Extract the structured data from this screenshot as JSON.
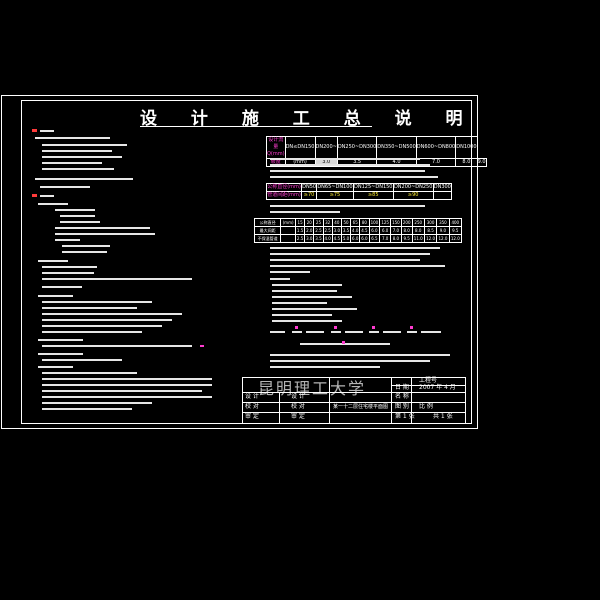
{
  "drawing": {
    "title": "设 计 施 工 总 说 明"
  },
  "table_a": {
    "row1": [
      "设计流量Q(mm)",
      "DN≤DN150",
      "DN200~",
      "DN250~DN300",
      "DN350~DN500",
      "DN600~DN800",
      "DN1000"
    ],
    "row2": [
      "坡度",
      "(mm)",
      "3.0",
      "3.5",
      "4.0",
      "7.0",
      "8.0",
      "9.0"
    ]
  },
  "table_b": {
    "row1": [
      "公称直径(mm)",
      "DN50",
      "DN65~DN100",
      "DN125~DN150",
      "DN200~DN250",
      "DN300"
    ],
    "row2": [
      "管道间距(mm)",
      "≥70",
      "≥75",
      "≥85",
      "≥90"
    ]
  },
  "table_c": {
    "rows": [
      [
        "公称直径",
        "(mm)",
        "15",
        "20",
        "25",
        "32",
        "40",
        "50",
        "65",
        "80",
        "100",
        "125",
        "150",
        "200",
        "250",
        "300",
        "350",
        "400"
      ],
      [
        "最大间距",
        "",
        "1.5",
        "2.0",
        "2.5",
        "2.5",
        "3.0",
        "3.5",
        "4.0",
        "4.5",
        "6.0",
        "6.0",
        "7.0",
        "8.0",
        "8.0",
        "8.5",
        "9.0",
        "9.5"
      ],
      [
        "不保温管道",
        "",
        "2.5",
        "3.0",
        "3.5",
        "4.0",
        "4.5",
        "5.0",
        "6.0",
        "6.0",
        "6.5",
        "7.0",
        "8.0",
        "9.5",
        "11.0",
        "12.0",
        "12.0",
        "12.0"
      ]
    ]
  },
  "title_block": {
    "watermark": "昆明理工大学",
    "project_label": "工程号",
    "drawing_number": "2007 年 4 月",
    "design_label": "设 计",
    "check_label": "校 对",
    "approve_label": "审 定",
    "drawing_name": "某一十二层住宅楼平面图",
    "sheet_label": "图 别",
    "scale_label": "比 例",
    "sheet_no_label": "第 1 张",
    "total_label": "共 1 张",
    "date_label": "日 期",
    "name_label": "名 称"
  }
}
